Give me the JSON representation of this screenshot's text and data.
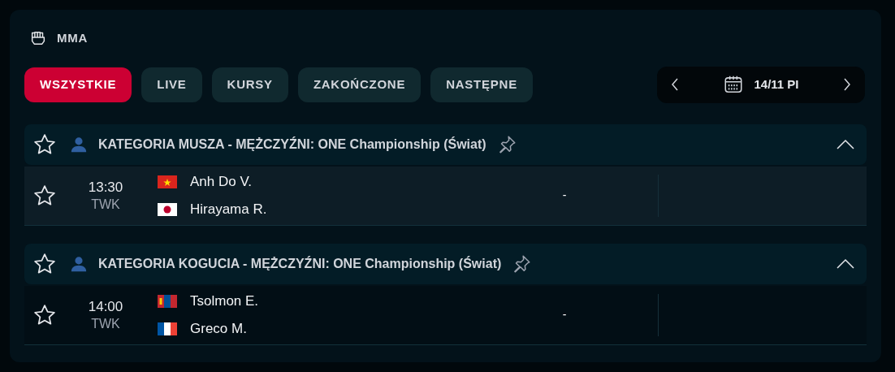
{
  "header": {
    "title": "MMA"
  },
  "filters": [
    {
      "label": "WSZYSTKIE",
      "selected": true
    },
    {
      "label": "LIVE",
      "selected": false
    },
    {
      "label": "KURSY",
      "selected": false
    },
    {
      "label": "ZAKOŃCZONE",
      "selected": false
    },
    {
      "label": "NASTĘPNE",
      "selected": false
    }
  ],
  "date_picker": {
    "label": "14/11 PI"
  },
  "groups": [
    {
      "title": "KATEGORIA MUSZA - MĘŻCZYŹNI: ONE Championship (Świat)",
      "favorite": false,
      "expanded": true,
      "matches": [
        {
          "time": "13:30",
          "status": "TWK",
          "favorite": false,
          "highlighted": true,
          "score": "-",
          "competitors": [
            {
              "name": "Anh Do V.",
              "kind": "vn"
            },
            {
              "name": "Hirayama R.",
              "kind": "jp"
            }
          ]
        }
      ]
    },
    {
      "title": "KATEGORIA KOGUCIA - MĘŻCZYŹNI: ONE Championship (Świat)",
      "favorite": false,
      "expanded": true,
      "matches": [
        {
          "time": "14:00",
          "status": "TWK",
          "favorite": false,
          "highlighted": false,
          "score": "-",
          "competitors": [
            {
              "name": "Tsolmon E.",
              "kind": "mn"
            },
            {
              "name": "Greco M.",
              "kind": "fr"
            }
          ]
        }
      ]
    }
  ]
}
